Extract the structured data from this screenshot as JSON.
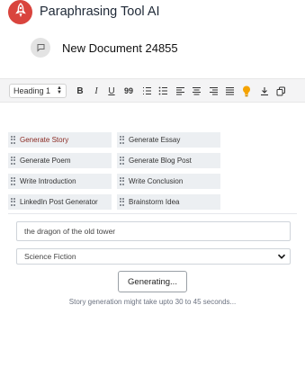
{
  "app": {
    "title": "Paraphrasing Tool AI",
    "logo_icon": "rocket-icon",
    "accent": "#d9443d"
  },
  "document": {
    "title": "New Document 24855",
    "icon": "message-icon"
  },
  "toolbar": {
    "heading_select": "Heading 1",
    "buttons": [
      "bold",
      "italic",
      "underline",
      "quote",
      "ordered-list",
      "bullet-list",
      "align-left",
      "align-center",
      "align-right",
      "align-justify",
      "lightbulb",
      "download",
      "copy"
    ],
    "bold_glyph": "B",
    "italic_glyph": "I",
    "underline_glyph": "U",
    "quote_glyph": "99",
    "lightbulb_color": "#f5a300"
  },
  "templates": [
    {
      "label": "Generate Story",
      "active": true
    },
    {
      "label": "Generate Essay",
      "active": false
    },
    {
      "label": "Generate Poem",
      "active": false
    },
    {
      "label": "Generate Blog Post",
      "active": false
    },
    {
      "label": "Write Introduction",
      "active": false
    },
    {
      "label": "Write Conclusion",
      "active": false
    },
    {
      "label": "LinkedIn Post Generator",
      "active": false
    },
    {
      "label": "Brainstorm Idea",
      "active": false
    }
  ],
  "story": {
    "prompt_value": "the dragon of the old tower",
    "genre_value": "Science Fiction",
    "button_label": "Generating...",
    "note": "Story generation might take upto 30 to 45 seconds..."
  }
}
